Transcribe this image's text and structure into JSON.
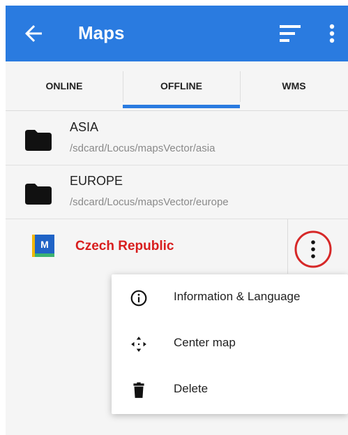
{
  "header": {
    "title": "Maps",
    "back_icon": "arrow-back-icon",
    "sort_icon": "sort-icon",
    "more_icon": "more-vert-icon"
  },
  "tabs": [
    {
      "label": "ONLINE",
      "selected": false
    },
    {
      "label": "OFFLINE",
      "selected": true
    },
    {
      "label": "WMS",
      "selected": false
    }
  ],
  "folders": [
    {
      "title": "ASIA",
      "path": "/sdcard/Locus/mapsVector/asia"
    },
    {
      "title": "EUROPE",
      "path": "/sdcard/Locus/mapsVector/europe"
    }
  ],
  "map_item": {
    "name": "Czech Republic",
    "name_color": "#d81e1e",
    "icon": "locus-map-icon"
  },
  "menu": {
    "items": [
      {
        "label": "Information & Language",
        "icon": "info-icon"
      },
      {
        "label": "Center map",
        "icon": "center-map-icon"
      },
      {
        "label": "Delete",
        "icon": "trash-icon"
      }
    ]
  },
  "colors": {
    "accent": "#2a7be0",
    "highlight_circle": "#d62828"
  }
}
